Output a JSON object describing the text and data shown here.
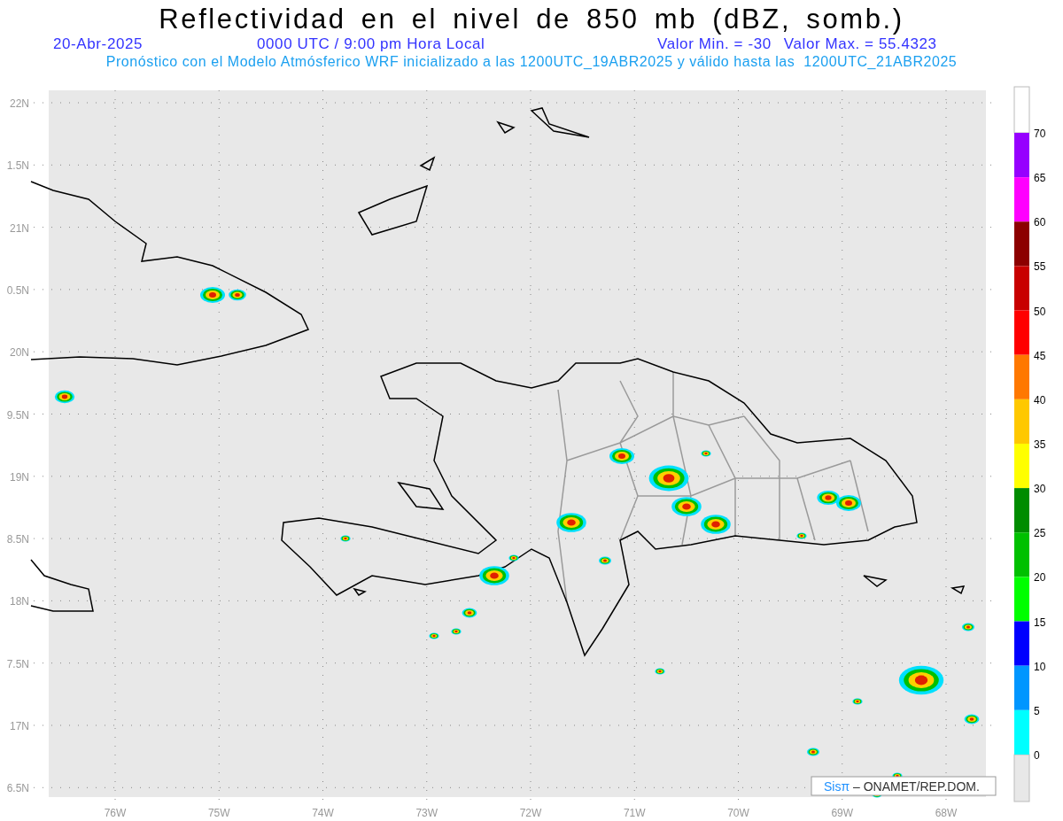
{
  "header": {
    "title": "Reflectividad en el nivel de 850 mb (dBZ, somb.)",
    "date": "20-Abr-2025",
    "time": "0000 UTC / 9:00 pm Hora Local",
    "min_value": "Valor Min. = -30",
    "max_value": "Valor Max. = 55.4323",
    "forecast_note": "Pronóstico con el Modelo Atmósferico WRF inicializado a las 1200UTC_19ABR2025 y válido hasta las  1200UTC_21ABR2025"
  },
  "map": {
    "y_labels": [
      "22N",
      "1.5N",
      "21N",
      "0.5N",
      "20N",
      "9.5N",
      "19N",
      "8.5N",
      "18N",
      "7.5N",
      "17N",
      "6.5N"
    ],
    "x_labels": [
      "76W",
      "75W",
      "74W",
      "73W",
      "72W",
      "71W",
      "70W",
      "69W",
      "68W"
    ],
    "credit": {
      "brand": "Sisπ",
      "text": "– ONAMET/REP.DOM."
    }
  },
  "colorbar": {
    "ticks": [
      "70",
      "65",
      "60",
      "55",
      "50",
      "45",
      "40",
      "35",
      "30",
      "25",
      "20",
      "15",
      "10",
      "5",
      "0"
    ],
    "bins": [
      {
        "color": "#9600ff"
      },
      {
        "color": "#ff00ff"
      },
      {
        "color": "#8c0000"
      },
      {
        "color": "#c80000"
      },
      {
        "color": "#ff0000"
      },
      {
        "color": "#ff7800"
      },
      {
        "color": "#ffc800"
      },
      {
        "color": "#ffff00"
      },
      {
        "color": "#008c00"
      },
      {
        "color": "#00c000"
      },
      {
        "color": "#00ff00"
      },
      {
        "color": "#0000ff"
      },
      {
        "color": "#0096ff"
      },
      {
        "color": "#00ffff"
      }
    ]
  }
}
